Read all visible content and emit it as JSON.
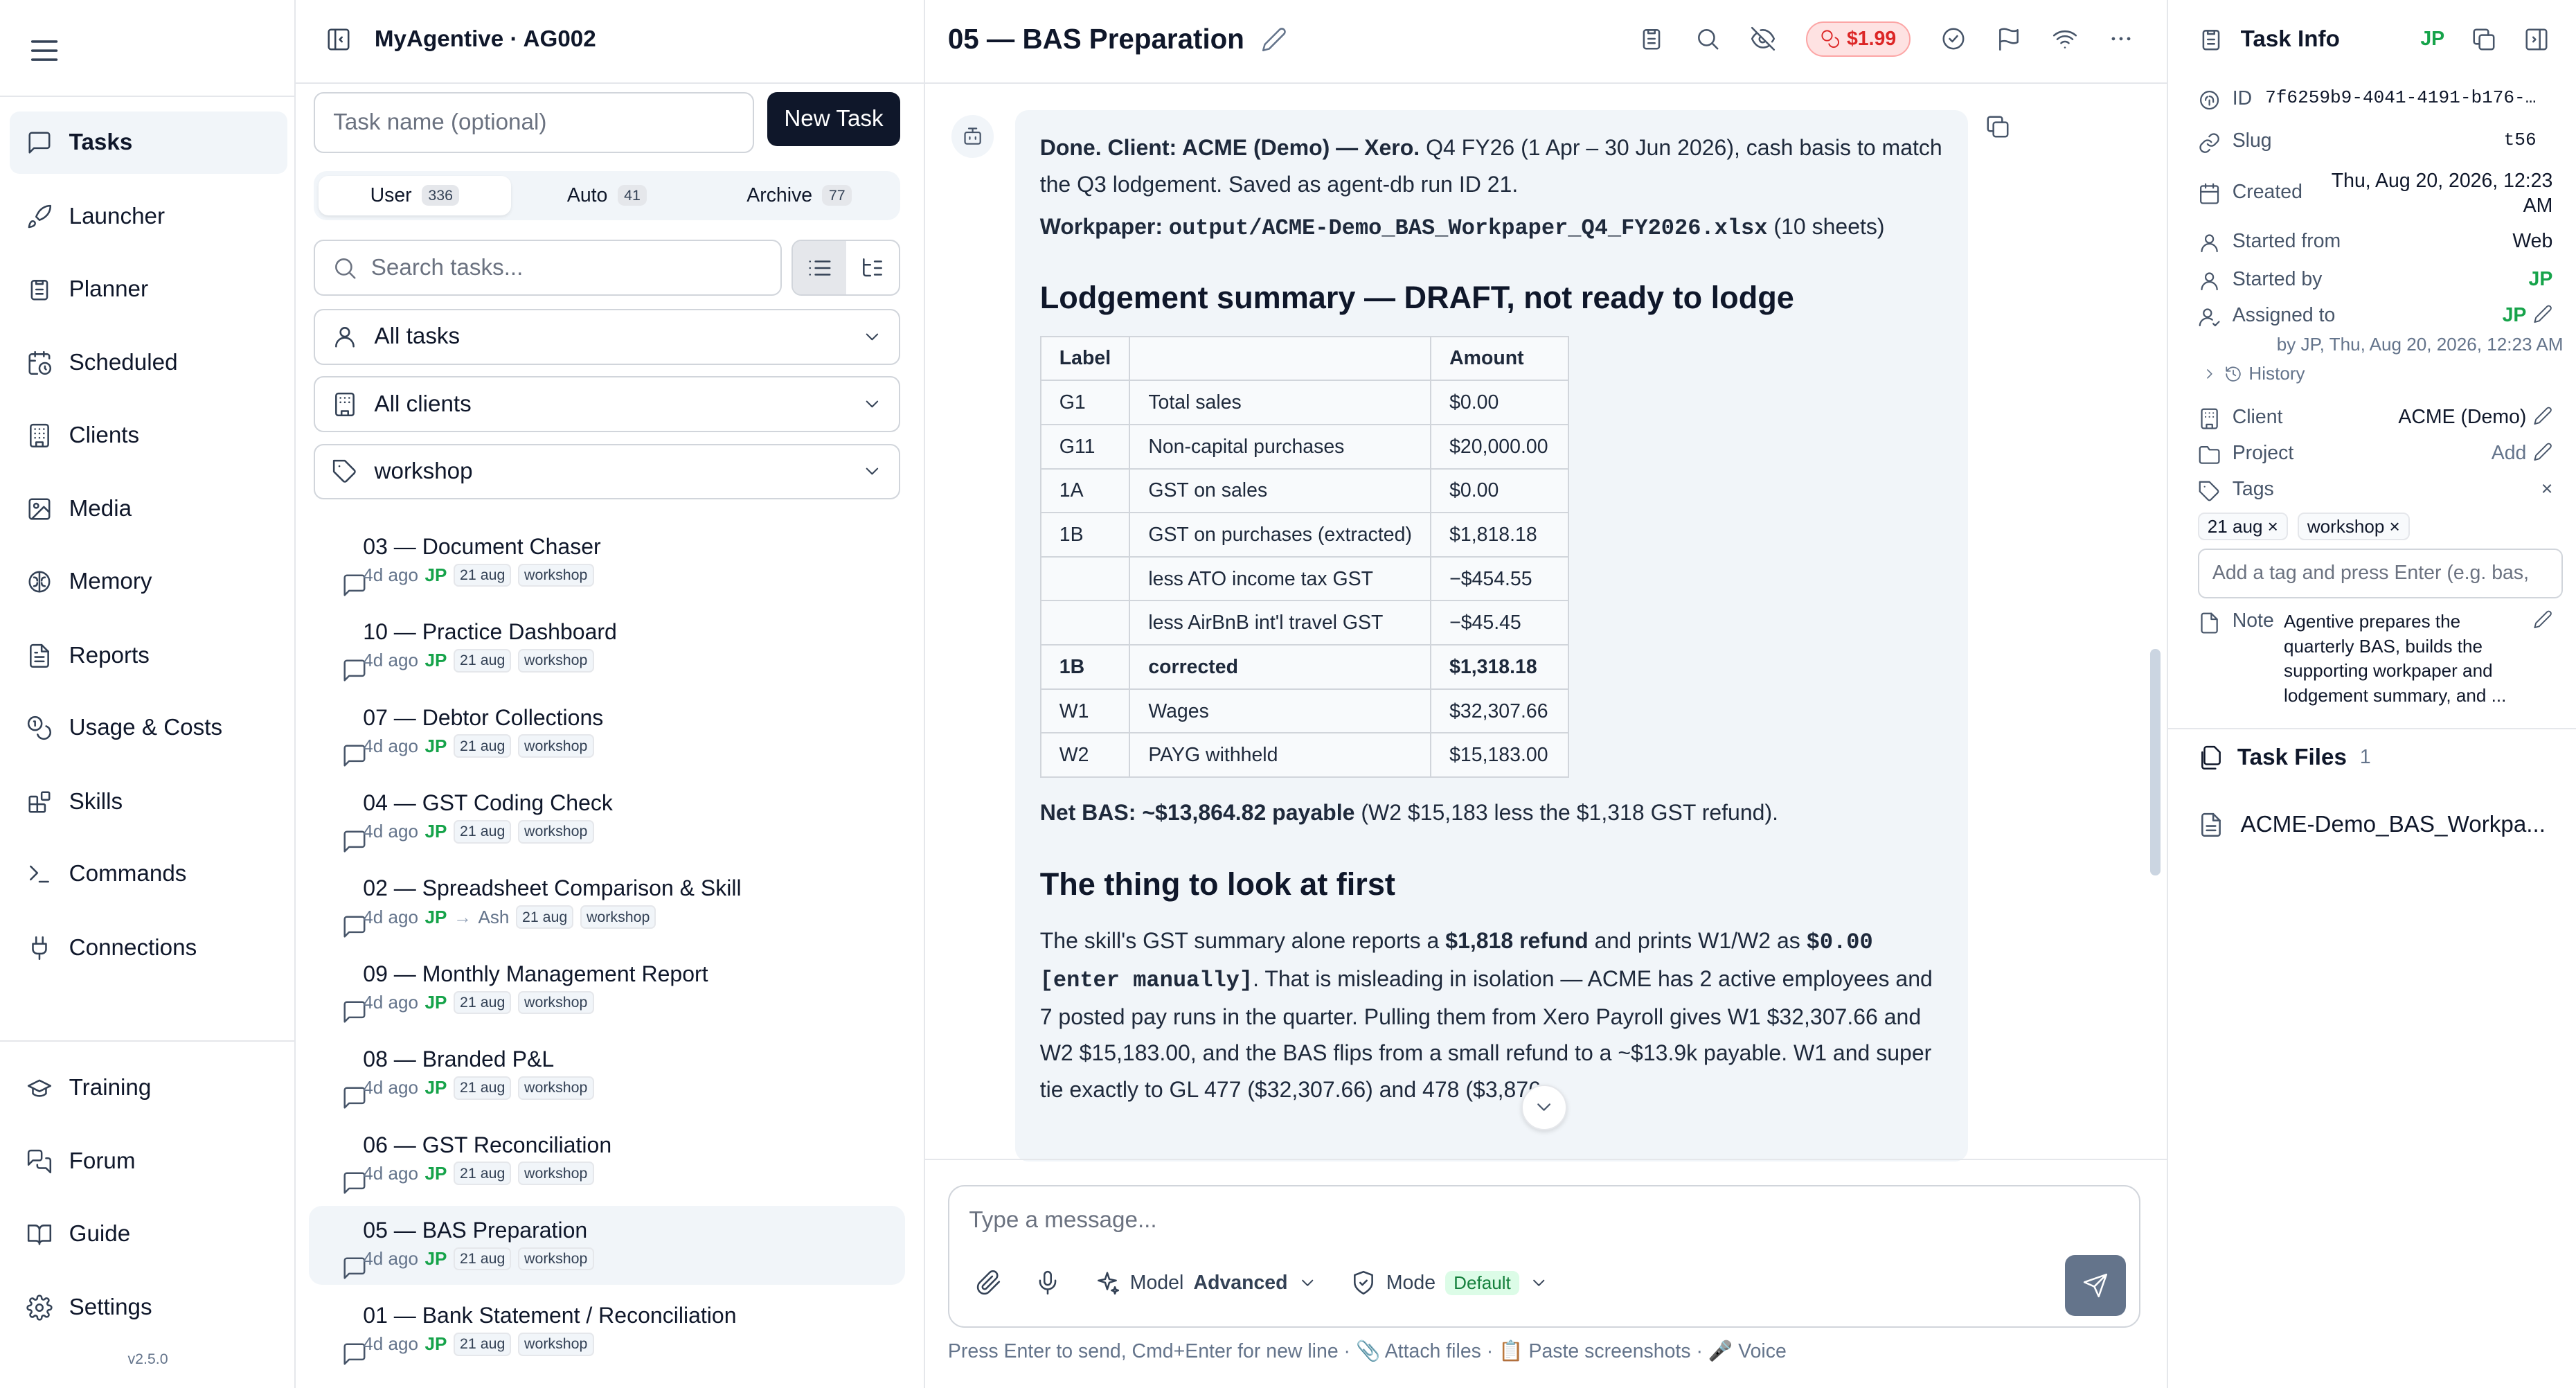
{
  "nav": {
    "items": [
      {
        "label": "Tasks",
        "icon": "message-square-icon",
        "active": true
      },
      {
        "label": "Launcher",
        "icon": "rocket-icon"
      },
      {
        "label": "Planner",
        "icon": "clipboard-icon"
      },
      {
        "label": "Scheduled",
        "icon": "calendar-clock-icon"
      },
      {
        "label": "Clients",
        "icon": "building-icon"
      },
      {
        "label": "Media",
        "icon": "image-icon"
      },
      {
        "label": "Memory",
        "icon": "brain-icon"
      },
      {
        "label": "Reports",
        "icon": "report-icon"
      },
      {
        "label": "Usage & Costs",
        "icon": "coins-icon"
      },
      {
        "label": "Skills",
        "icon": "blocks-icon"
      },
      {
        "label": "Commands",
        "icon": "terminal-icon"
      },
      {
        "label": "Connections",
        "icon": "plug-icon"
      }
    ],
    "bottom_items": [
      {
        "label": "Training",
        "icon": "graduation-cap-icon"
      },
      {
        "label": "Forum",
        "icon": "messages-icon"
      },
      {
        "label": "Guide",
        "icon": "book-icon"
      },
      {
        "label": "Settings",
        "icon": "gear-icon"
      }
    ],
    "version": "v2.5.0"
  },
  "tasks_panel": {
    "title": "MyAgentive · AG002",
    "task_name_placeholder": "Task name (optional)",
    "new_task_label": "New Task",
    "tabs": [
      {
        "label": "User",
        "count": "336",
        "active": true
      },
      {
        "label": "Auto",
        "count": "41"
      },
      {
        "label": "Archive",
        "count": "77"
      }
    ],
    "search_placeholder": "Search tasks...",
    "filters": {
      "assignee": "All tasks",
      "client": "All clients",
      "tag": "workshop"
    },
    "items": [
      {
        "name": "03 — Document Chaser",
        "age": "4d ago",
        "user": "JP",
        "tags": [
          "21 aug",
          "workshop"
        ]
      },
      {
        "name": "10 — Practice Dashboard",
        "age": "4d ago",
        "user": "JP",
        "tags": [
          "21 aug",
          "workshop"
        ]
      },
      {
        "name": "07 — Debtor Collections",
        "age": "4d ago",
        "user": "JP",
        "tags": [
          "21 aug",
          "workshop"
        ]
      },
      {
        "name": "04 — GST Coding Check",
        "age": "4d ago",
        "user": "JP",
        "tags": [
          "21 aug",
          "workshop"
        ]
      },
      {
        "name": "02 — Spreadsheet Comparison & Skill",
        "age": "4d ago",
        "user": "JP",
        "arrow": "→",
        "assignee": "Ash",
        "tags": [
          "21 aug",
          "workshop"
        ]
      },
      {
        "name": "09 — Monthly Management Report",
        "age": "4d ago",
        "user": "JP",
        "tags": [
          "21 aug",
          "workshop"
        ]
      },
      {
        "name": "08 — Branded P&L",
        "age": "4d ago",
        "user": "JP",
        "tags": [
          "21 aug",
          "workshop"
        ]
      },
      {
        "name": "06 — GST Reconciliation",
        "age": "4d ago",
        "user": "JP",
        "tags": [
          "21 aug",
          "workshop"
        ]
      },
      {
        "name": "05 — BAS Preparation",
        "age": "4d ago",
        "user": "JP",
        "tags": [
          "21 aug",
          "workshop"
        ],
        "active": true
      },
      {
        "name": "01 — Bank Statement / Reconciliation",
        "age": "4d ago",
        "user": "JP",
        "tags": [
          "21 aug",
          "workshop"
        ]
      }
    ]
  },
  "main": {
    "title": "05 — BAS Preparation",
    "cost": "$1.99",
    "message": {
      "p1_done": "Done.",
      "p1_client": "Client: ACME (Demo) — Xero.",
      "p1_rest": "Q4 FY26 (1 Apr – 30 Jun 2026), cash basis to match the Q3 lodgement. Saved as agent-db run ID 21.",
      "p2_label": "Workpaper:",
      "p2_path": "output/ACME-Demo_BAS_Workpaper_Q4_FY2026.xlsx",
      "p2_suffix": "(10 sheets)",
      "h_summary": "Lodgement summary — DRAFT, not ready to lodge",
      "table_headers": [
        "Label",
        "",
        "Amount"
      ],
      "table_rows": [
        {
          "label": "G1",
          "desc": "Total sales",
          "amount": "$0.00"
        },
        {
          "label": "G11",
          "desc": "Non-capital purchases",
          "amount": "$20,000.00"
        },
        {
          "label": "1A",
          "desc": "GST on sales",
          "amount": "$0.00"
        },
        {
          "label": "1B",
          "desc": "GST on purchases (extracted)",
          "amount": "$1,818.18"
        },
        {
          "label": "",
          "desc": "less ATO income tax GST",
          "amount": "−$454.55"
        },
        {
          "label": "",
          "desc": "less AirBnB int'l travel GST",
          "amount": "−$45.45"
        },
        {
          "label": "1B",
          "desc": "corrected",
          "amount": "$1,318.18",
          "bold": true
        },
        {
          "label": "W1",
          "desc": "Wages",
          "amount": "$32,307.66"
        },
        {
          "label": "W2",
          "desc": "PAYG withheld",
          "amount": "$15,183.00"
        }
      ],
      "net_bold": "Net BAS: ~$13,864.82 payable",
      "net_rest": "(W2 $15,183 less the $1,318 GST refund).",
      "h_first": "The thing to look at first",
      "p3_a": "The skill's GST summary alone reports a",
      "p3_b": "$1,818 refund",
      "p3_c": "and prints W1/W2 as",
      "p3_d": "$0.00 [enter manually]",
      "p3_e": ". That is misleading in isolation — ACME has 2 active employees and 7 posted pay runs in the quarter. Pulling them from Xero Payroll gives W1 $32,307.66 and W2 $15,183.00, and the BAS flips from a small refund to a ~$13.9k payable. W1 and super tie exactly to GL 477 ($32,307.66) and 478 ($3,876."
    },
    "composer": {
      "placeholder": "Type a message...",
      "model_label": "Model",
      "model_value": "Advanced",
      "mode_label": "Mode",
      "mode_value": "Default"
    },
    "hint": "Press Enter to send, Cmd+Enter for new line · 📎 Attach files · 📋 Paste screenshots · 🎤 Voice"
  },
  "info": {
    "title": "Task Info",
    "user": "JP",
    "id_label": "ID",
    "id_value": "7f6259b9-4041-4191-b176-…",
    "slug_label": "Slug",
    "slug_value": "t56",
    "created_label": "Created",
    "created_value": "Thu, Aug 20, 2026, 12:23 AM",
    "started_from_label": "Started from",
    "started_from_value": "Web",
    "started_by_label": "Started by",
    "started_by_value": "JP",
    "assigned_label": "Assigned to",
    "assigned_value": "JP",
    "assigned_note": "by JP, Thu, Aug 20, 2026, 12:23 AM",
    "history_label": "History",
    "client_label": "Client",
    "client_value": "ACME (Demo)",
    "project_label": "Project",
    "project_value": "Add",
    "tags_label": "Tags",
    "tags": [
      "21 aug",
      "workshop"
    ],
    "tag_placeholder": "Add a tag and press Enter (e.g. bas,",
    "note_label": "Note",
    "note_value": "Agentive prepares the quarterly BAS, builds the supporting workpaper and lodgement summary, and ...",
    "files_label": "Task Files",
    "files_count": "1",
    "files": [
      "ACME-Demo_BAS_Workpa..."
    ]
  },
  "colors": {
    "accent_green": "#16a34a",
    "cost_red": "#dc2626",
    "primary_dark": "#0f172a"
  }
}
